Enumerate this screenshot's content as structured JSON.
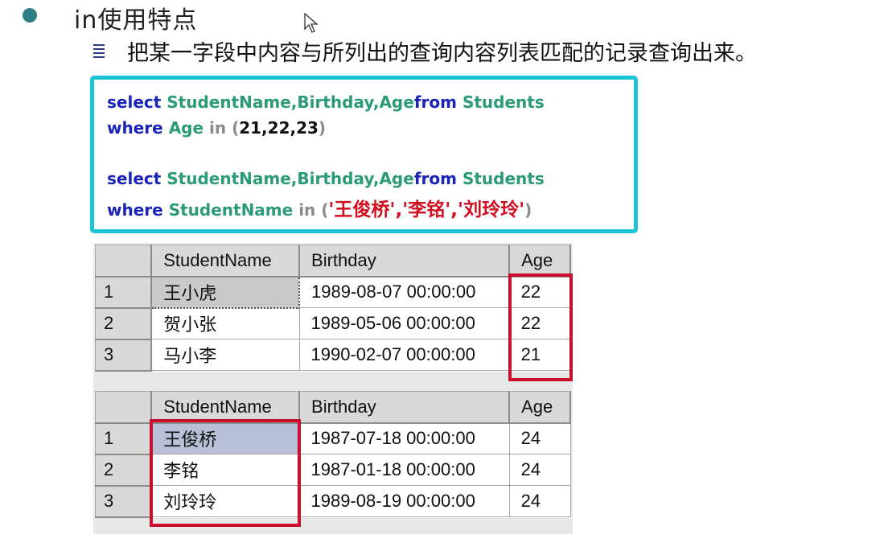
{
  "heading": {
    "title": "in使用特点",
    "subtitle": "把某一字段中内容与所列出的查询内容列表匹配的记录查询出来。"
  },
  "code": {
    "q1_line1": {
      "select": "select",
      "cols": "StudentName,Birthday,Age",
      "from": "from",
      "table": "Students"
    },
    "q1_line2": {
      "where": "where",
      "col": "Age",
      "in": "in",
      "open": "(",
      "values": "21,22,23",
      "close": ")"
    },
    "q2_line1": {
      "select": "select",
      "cols": "StudentName,Birthday,Age",
      "from": "from",
      "table": "Students"
    },
    "q2_line2": {
      "where": "where",
      "col": "StudentName",
      "in": "in",
      "open": "(",
      "values": "'王俊桥','李铭','刘玲玲'",
      "close": ")"
    }
  },
  "result1": {
    "columns": [
      "StudentName",
      "Birthday",
      "Age"
    ],
    "rows": [
      {
        "num": "1",
        "name": "王小虎",
        "birthday": "1989-08-07 00:00:00",
        "age": "22"
      },
      {
        "num": "2",
        "name": "贺小张",
        "birthday": "1989-05-06 00:00:00",
        "age": "22"
      },
      {
        "num": "3",
        "name": "马小李",
        "birthday": "1990-02-07 00:00:00",
        "age": "21"
      }
    ]
  },
  "result2": {
    "columns": [
      "StudentName",
      "Birthday",
      "Age"
    ],
    "rows": [
      {
        "num": "1",
        "name": "王俊桥",
        "birthday": "1987-07-18 00:00:00",
        "age": "24"
      },
      {
        "num": "2",
        "name": "李铭",
        "birthday": "1987-01-18 00:00:00",
        "age": "24"
      },
      {
        "num": "3",
        "name": "刘玲玲",
        "birthday": "1989-08-19 00:00:00",
        "age": "24"
      }
    ]
  },
  "colors": {
    "accent_border": "#1ec3d6",
    "keyword": "#1a23b8",
    "identifier": "#2a9a78",
    "string": "#d01020",
    "highlight_box": "#c8102e"
  }
}
